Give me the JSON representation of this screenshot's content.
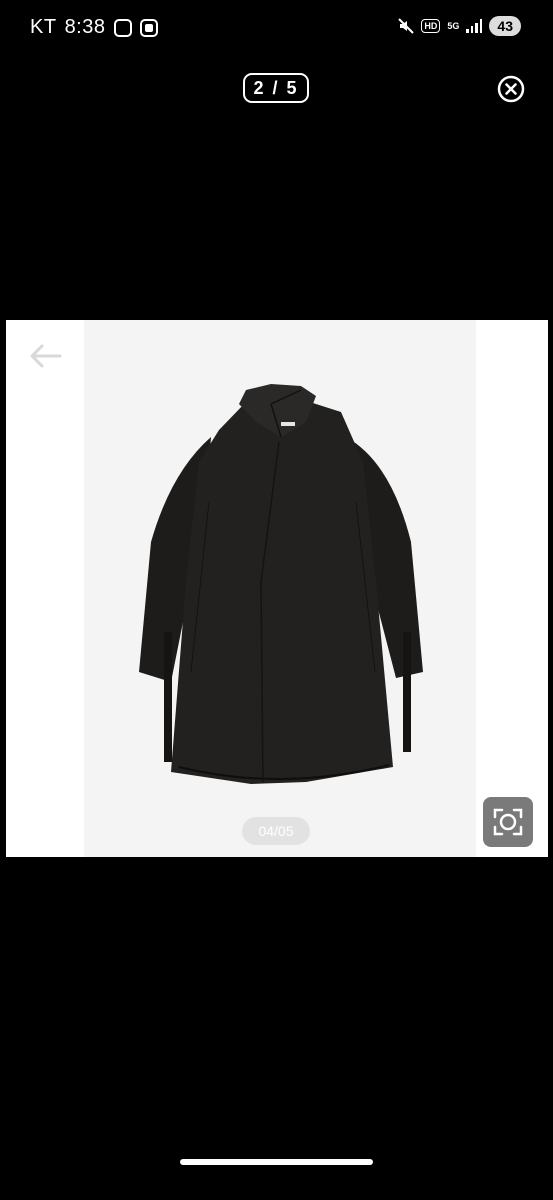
{
  "status_bar": {
    "carrier": "KT",
    "time": "8:38",
    "hd_label": "HD",
    "network_label": "5G",
    "battery": "43"
  },
  "viewer": {
    "counter": "2 / 5",
    "image_page": "04/05"
  },
  "icons": {
    "close": "close-icon",
    "back": "arrow-left-icon",
    "scan": "camera-scan-icon",
    "mute": "mute-icon"
  }
}
